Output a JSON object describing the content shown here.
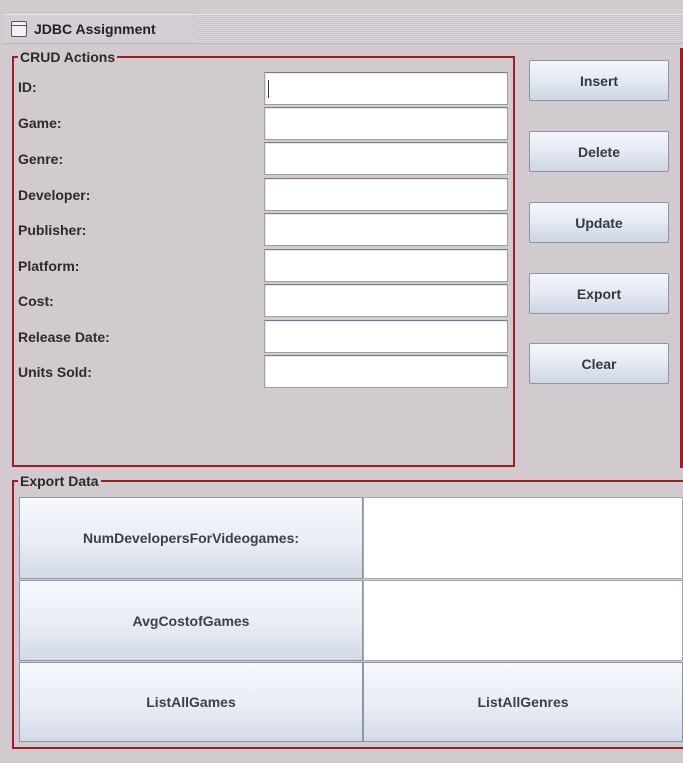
{
  "window": {
    "title": "JDBC Assignment",
    "icon": "window-icon"
  },
  "crud": {
    "legend": "CRUD Actions",
    "fields": [
      {
        "key": "id",
        "label": "ID:",
        "value": ""
      },
      {
        "key": "game",
        "label": "Game:",
        "value": ""
      },
      {
        "key": "genre",
        "label": "Genre:",
        "value": ""
      },
      {
        "key": "developer",
        "label": "Developer:",
        "value": ""
      },
      {
        "key": "publisher",
        "label": "Publisher:",
        "value": ""
      },
      {
        "key": "platform",
        "label": "Platform:",
        "value": ""
      },
      {
        "key": "cost",
        "label": "Cost:",
        "value": ""
      },
      {
        "key": "release_date",
        "label": "Release Date:",
        "value": ""
      },
      {
        "key": "units_sold",
        "label": "Units Sold:",
        "value": ""
      }
    ]
  },
  "actions": {
    "insert": "Insert",
    "delete": "Delete",
    "update": "Update",
    "export": "Export",
    "clear": "Clear"
  },
  "export_data": {
    "legend": "Export Data",
    "num_developers_button": "NumDevelopersForVideogames:",
    "num_developers_result": "",
    "avg_cost_button": "AvgCostofGames",
    "avg_cost_result": "",
    "list_all_games_button": "ListAllGames",
    "list_all_genres_button": "ListAllGenres"
  },
  "colors": {
    "group_border": "#a01c26",
    "window_bg": "#d1cbd0"
  }
}
